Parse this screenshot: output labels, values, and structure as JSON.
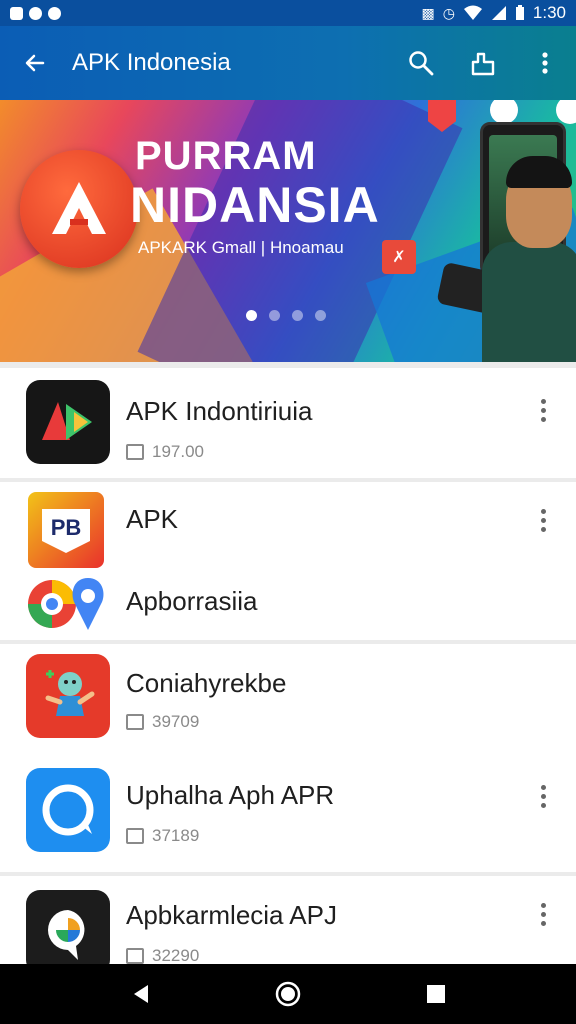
{
  "status_bar": {
    "time": "1:30"
  },
  "toolbar": {
    "title": "APK Indonesia"
  },
  "banner": {
    "title_line1": "PURRAM",
    "title_line2": "NIDANSIA",
    "subtitle": "APKARK Gmall | Hnoamau",
    "dots": 4,
    "active_dot": 0
  },
  "apps": [
    {
      "title": "APK Indontiriuia",
      "meta": "197.00"
    },
    {
      "title": "APK"
    },
    {
      "title": "Apborrasiia"
    },
    {
      "title": "Coniahyrekbe",
      "meta": "39709"
    },
    {
      "title": "Uphalha Aph APR",
      "meta": "37189"
    },
    {
      "title": "Apbkarmlecia APJ",
      "meta": "32290"
    }
  ],
  "colors": {
    "status_bar": "#0a4f9e",
    "toolbar_start": "#0b5db5",
    "toolbar_end": "#0a7f8f",
    "navbar": "#000000"
  }
}
